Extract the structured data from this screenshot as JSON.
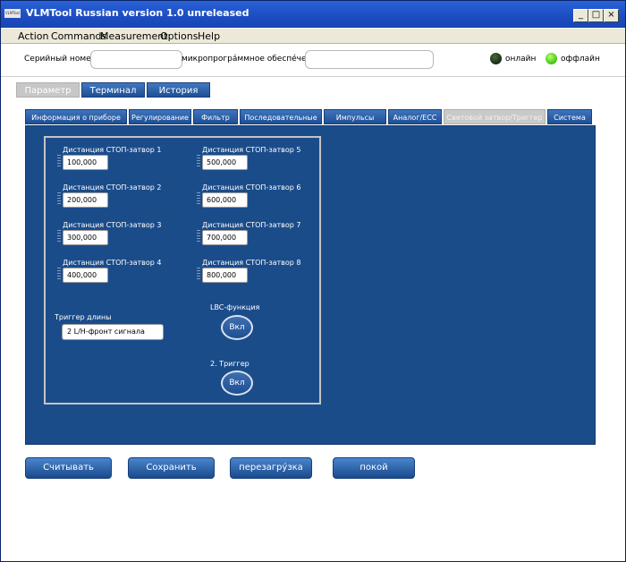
{
  "window": {
    "title": "VLMTool  Russian version 1.0 unreleased",
    "icon_text": "VLMTool"
  },
  "menu": [
    "Action",
    "Commands",
    "Measurement",
    "Options",
    "Help"
  ],
  "info": {
    "serial_label": "Серийный номер",
    "serial_value": "",
    "firmware_label": "микропрогра́ммное обеспе́чение",
    "firmware_value": "",
    "online_label": "онлайн",
    "offline_label": "оффлайн"
  },
  "main_tabs": [
    "Параметр",
    "Терминал",
    "История"
  ],
  "sub_tabs": [
    "Информация о приборе",
    "Регулирование",
    "Фильтр",
    "Последовательные",
    "Импульсы",
    "Аналог/ЕСС",
    "Световой затвор/Триггер",
    "Система"
  ],
  "distances": [
    {
      "label": "Дистанция СТОП-затвор 1",
      "value": "100,000"
    },
    {
      "label": "Дистанция СТОП-затвор 2",
      "value": "200,000"
    },
    {
      "label": "Дистанция СТОП-затвор 3",
      "value": "300,000"
    },
    {
      "label": "Дистанция СТОП-затвор 4",
      "value": "400,000"
    },
    {
      "label": "Дистанция СТОП-затвор 5",
      "value": "500,000"
    },
    {
      "label": "Дистанция СТОП-затвор 6",
      "value": "600,000"
    },
    {
      "label": "Дистанция СТОП-затвор 7",
      "value": "700,000"
    },
    {
      "label": "Дистанция СТОП-затвор 8",
      "value": "800,000"
    }
  ],
  "trigger": {
    "label": "Триггер длины",
    "value": "2 L/H-фронт сигнала"
  },
  "lbc": {
    "label": "LBC-функция",
    "button": "Вкл"
  },
  "trigger2": {
    "label": "2. Триггер",
    "button": "Вкл"
  },
  "actions": [
    "Считывать",
    "Сохранить",
    "перезагру́зка",
    "покой"
  ],
  "colors": {
    "panel": "#1b4c8a",
    "titlebar": "#1c4cc0",
    "led_online": "#1a2a12",
    "led_offline": "#3fc21a"
  }
}
